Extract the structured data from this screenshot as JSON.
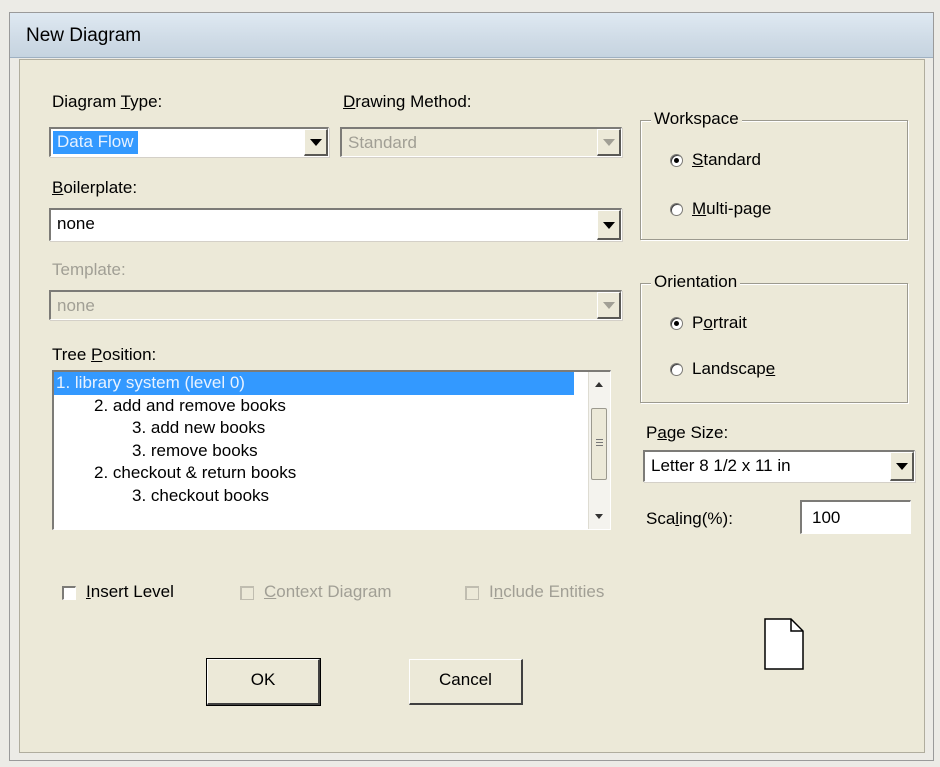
{
  "window": {
    "title": "New Diagram"
  },
  "diagram_type": {
    "label": "Diagram ",
    "mnemonic": "T",
    "label_rest": "ype:",
    "value": "Data Flow"
  },
  "drawing_method": {
    "mnemonic": "D",
    "label_rest": "rawing Method:",
    "value": "Standard"
  },
  "boilerplate": {
    "mnemonic": "B",
    "label_rest": "oilerplate:",
    "value": "none"
  },
  "template": {
    "label": "Template:",
    "value": "none"
  },
  "tree_position": {
    "label": "Tree ",
    "mnemonic": "P",
    "label_rest": "osition:",
    "items": [
      {
        "text": "1. library system (level 0)",
        "indent": 0,
        "selected": true
      },
      {
        "text": "2. add and remove books",
        "indent": 1,
        "selected": false
      },
      {
        "text": "3. add new books",
        "indent": 2,
        "selected": false
      },
      {
        "text": "3. remove books",
        "indent": 2,
        "selected": false
      },
      {
        "text": "2. checkout & return books",
        "indent": 1,
        "selected": false
      },
      {
        "text": "3. checkout books",
        "indent": 2,
        "selected": false
      }
    ]
  },
  "workspace": {
    "legend": "Workspace",
    "standard": {
      "mnemonic": "S",
      "rest": "tandard",
      "selected": true
    },
    "multipage": {
      "mnemonic": "M",
      "rest": "ulti-page",
      "selected": false
    }
  },
  "orientation": {
    "legend": "Orientation",
    "portrait": {
      "pre": "P",
      "mnemonic": "o",
      "rest": "rtrait",
      "selected": true
    },
    "landscape": {
      "pre": "Landscap",
      "mnemonic": "e",
      "rest": "",
      "selected": false
    }
  },
  "page_size": {
    "pre": "P",
    "mnemonic": "a",
    "rest": "ge Size:",
    "value": "Letter 8 1/2 x 11 in"
  },
  "scaling": {
    "pre": "Sca",
    "mnemonic": "l",
    "rest": "ing(%):",
    "value": "100"
  },
  "options": {
    "insert_level": {
      "mnemonic": "I",
      "rest": "nsert Level",
      "checked": false
    },
    "context_diagram": {
      "mnemonic": "C",
      "rest": "ontext Diagram",
      "checked": false
    },
    "include_entities": {
      "pre": "I",
      "mnemonic": "n",
      "rest": "clude Entities",
      "checked": false
    }
  },
  "buttons": {
    "ok": "OK",
    "cancel": "Cancel"
  },
  "icons": {
    "page_preview": "page-icon"
  }
}
